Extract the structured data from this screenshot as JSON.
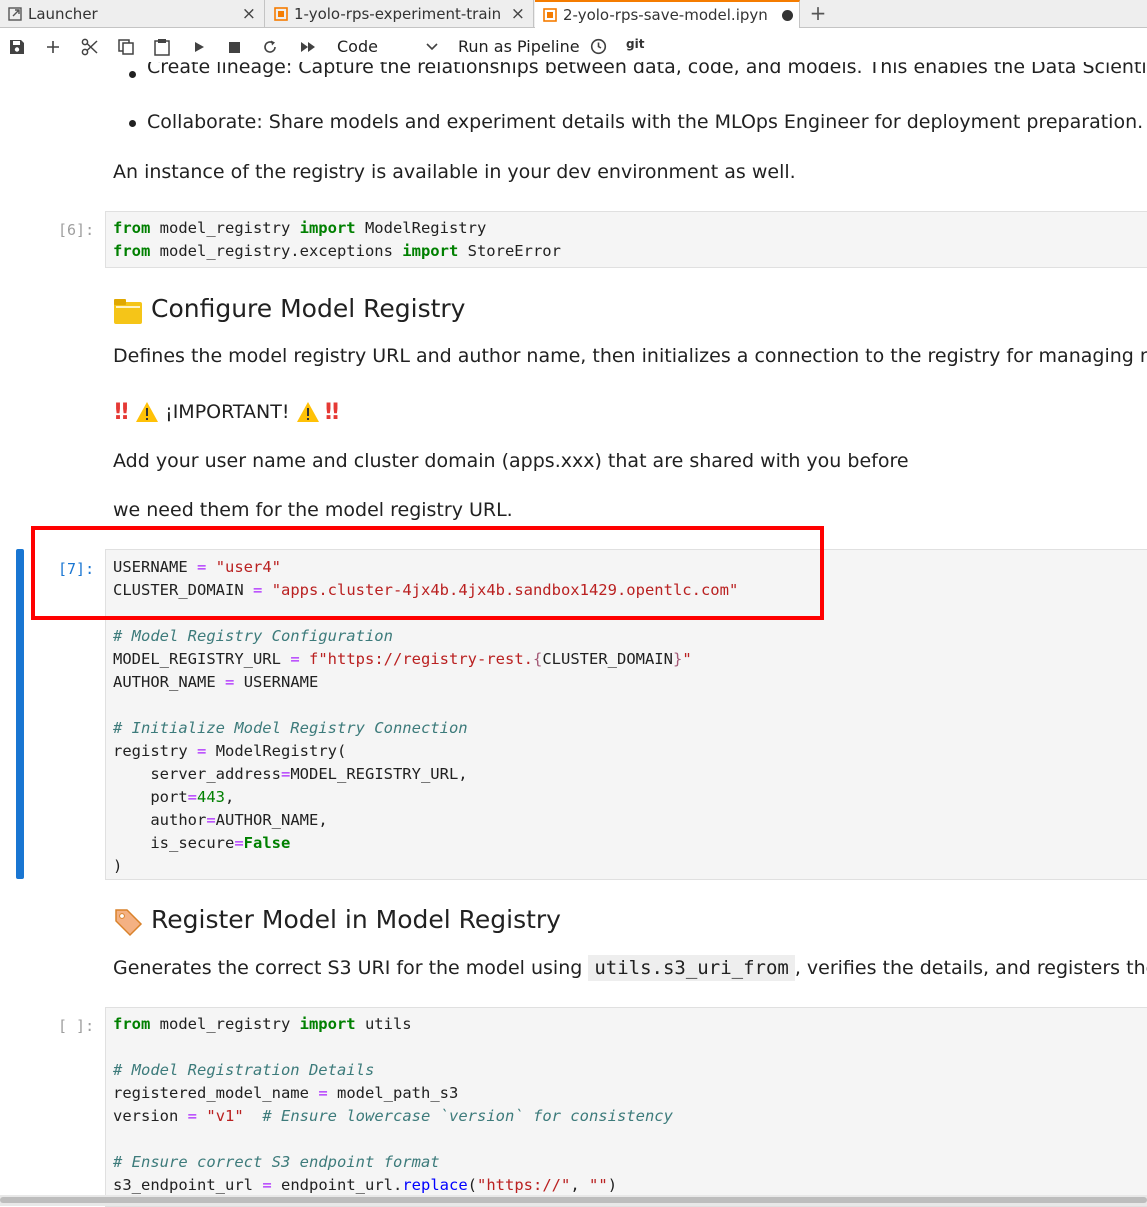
{
  "tabs": [
    {
      "label": "Launcher",
      "icon": "launcher-icon"
    },
    {
      "label": "1-yolo-rps-experiment-train",
      "icon": "notebook-icon"
    },
    {
      "label": "2-yolo-rps-save-model.ipynb",
      "icon": "notebook-icon"
    }
  ],
  "toolbar": {
    "cell_type": "Code",
    "run_pipeline": "Run as Pipeline",
    "git": "git"
  },
  "notebook": {
    "bullet1": "Create lineage: Capture the relationships between data, code, and models. This enables the Data Scientist t",
    "bullet2": "Collaborate: Share models and experiment details with the MLOps Engineer for deployment preparation. T",
    "para_instance": "An instance of the registry is available in your dev environment as well.",
    "cell6": {
      "prompt": "[6]:",
      "line1": [
        "from",
        " model_registry ",
        "import",
        " ModelRegistry"
      ],
      "line2": [
        "from",
        " model_registry.exceptions ",
        "import",
        " StoreError"
      ]
    },
    "heading_configure": "Configure Model Registry",
    "para_defines": "Defines the model registry URL and author name, then initializes a connection to the registry for managing mo",
    "important": "¡IMPORTANT!",
    "para_add": "Add your user name and cluster domain (apps.xxx) that are shared with you before",
    "para_need": "we need them for the model registry URL.",
    "cell7": {
      "prompt": "[7]:",
      "username_var": "USERNAME",
      "username_val": "\"user4\"",
      "cluster_var": "CLUSTER_DOMAIN",
      "cluster_val": "\"apps.cluster-4jx4b.4jx4b.sandbox1429.opentlc.com\"",
      "comment_config": "# Model Registry Configuration",
      "url_var": "MODEL_REGISTRY_URL",
      "url_f": "f\"https://registry-rest.",
      "url_brace_open": "{",
      "url_domain": "CLUSTER_DOMAIN",
      "url_brace_close": "}",
      "url_end": "\"",
      "author_var": "AUTHOR_NAME",
      "author_val": "USERNAME",
      "comment_init": "# Initialize Model Registry Connection",
      "reg_var": "registry",
      "reg_call": "ModelRegistry(",
      "arg_server": "server_address",
      "arg_server_val": "MODEL_REGISTRY_URL,",
      "arg_port": "port",
      "arg_port_val": "443",
      "arg_author": "author",
      "arg_author_val": "AUTHOR_NAME,",
      "arg_secure": "is_secure",
      "arg_secure_val": "False",
      "close_paren": ")"
    },
    "heading_register": "Register Model in Model Registry",
    "para_generates_pre": "Generates the correct S3 URI for the model using ",
    "para_generates_code": "utils.s3_uri_from",
    "para_generates_post": ", verifies the details, and registers the",
    "cell8": {
      "prompt": "[ ]:",
      "line1_from": "from",
      "line1_mod": " model_registry ",
      "line1_import": "import",
      "line1_name": " utils",
      "comment_details": "# Model Registration Details",
      "rmn_var": "registered_model_name",
      "rmn_val": "model_path_s3",
      "ver_var": "version",
      "ver_val": "\"v1\"",
      "ver_comment": "# Ensure lowercase `version` for consistency",
      "comment_s3": "# Ensure correct S3 endpoint format",
      "s3_var": "s3_endpoint_url",
      "s3_obj": "endpoint_url.",
      "s3_fn": "replace",
      "s3_args_open": "(",
      "s3_arg1": "\"https://\"",
      "s3_comma": ", ",
      "s3_arg2": "\"\"",
      "s3_args_close": ")"
    }
  },
  "colors": {
    "accent": "#1976d2",
    "highlight": "#ff0000",
    "tab_active": "#f57c00"
  }
}
